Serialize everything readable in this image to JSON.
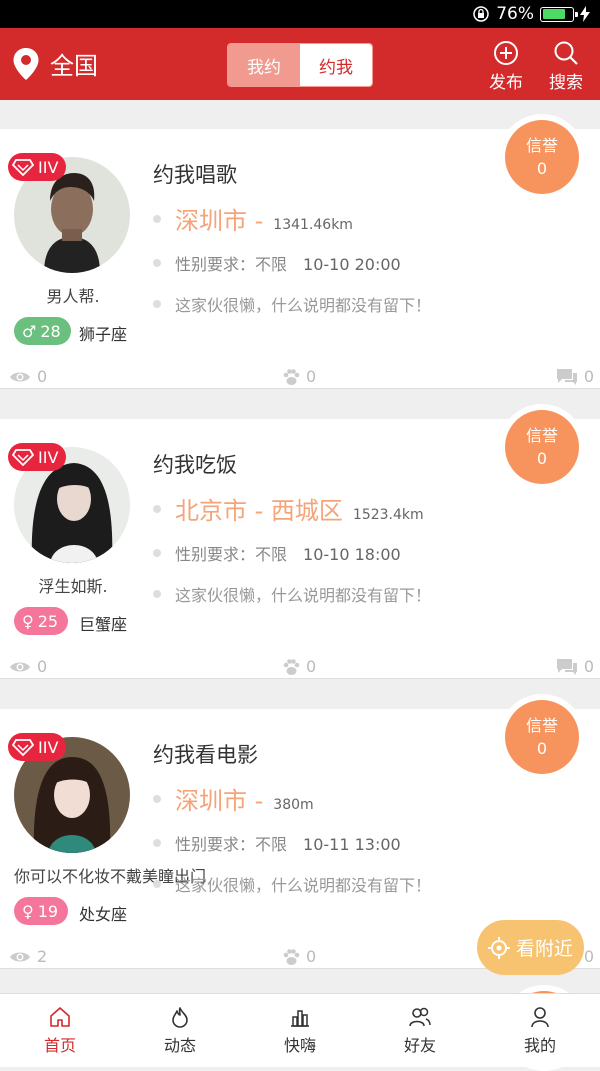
{
  "status_bar": {
    "battery": "76%",
    "battery_level": 0.76
  },
  "header": {
    "location": "全国",
    "segments": [
      "我约",
      "约我"
    ],
    "active_segment": "约我",
    "publish_label": "发布",
    "search_label": "搜索"
  },
  "colors": {
    "primary": "#d32a2c",
    "credit": "#f7945d",
    "city": "#f5a47a",
    "male": "#6cc07f",
    "female": "#f4769b",
    "vip": "#e8253f",
    "nearby": "#f8c370"
  },
  "cards": [
    {
      "vip": "IIV",
      "nickname": "男人帮.",
      "gender": "male",
      "gender_symbol": "♂",
      "age": "28",
      "zodiac": "狮子座",
      "title": "约我唱歌",
      "city": "深圳市 -",
      "distance": "1341.46km",
      "requirement": "性别要求：不限",
      "time": "10-10 20:00",
      "note": "这家伙很懒，什么说明都没有留下！",
      "credit_label": "信誉",
      "credit_value": "0",
      "views": "0",
      "likes": "0",
      "comments": "0"
    },
    {
      "vip": "IIV",
      "nickname": "浮生如斯.",
      "gender": "female",
      "gender_symbol": "♀",
      "age": "25",
      "zodiac": "巨蟹座",
      "title": "约我吃饭",
      "city": "北京市 - 西城区",
      "distance": "1523.4km",
      "requirement": "性别要求：不限",
      "time": "10-10 18:00",
      "note": "这家伙很懒，什么说明都没有留下！",
      "credit_label": "信誉",
      "credit_value": "0",
      "views": "0",
      "likes": "0",
      "comments": "0"
    },
    {
      "vip": "IIV",
      "nickname": "你可以不化妆不戴美瞳出门",
      "gender": "female",
      "gender_symbol": "♀",
      "age": "19",
      "zodiac": "处女座",
      "title": "约我看电影",
      "city": "深圳市 -",
      "distance": "380m",
      "requirement": "性别要求：不限",
      "time": "10-11 13:00",
      "note": "这家伙很懒，什么说明都没有留下！",
      "credit_label": "信誉",
      "credit_value": "0",
      "views": "2",
      "likes": "0",
      "comments": "0"
    }
  ],
  "nearby_button": "看附近",
  "tabs": [
    {
      "label": "首页",
      "icon": "home-icon",
      "active": true
    },
    {
      "label": "动态",
      "icon": "flame-icon",
      "active": false
    },
    {
      "label": "快嗨",
      "icon": "chart-icon",
      "active": false
    },
    {
      "label": "好友",
      "icon": "friends-icon",
      "active": false
    },
    {
      "label": "我的",
      "icon": "person-icon",
      "active": false
    }
  ]
}
